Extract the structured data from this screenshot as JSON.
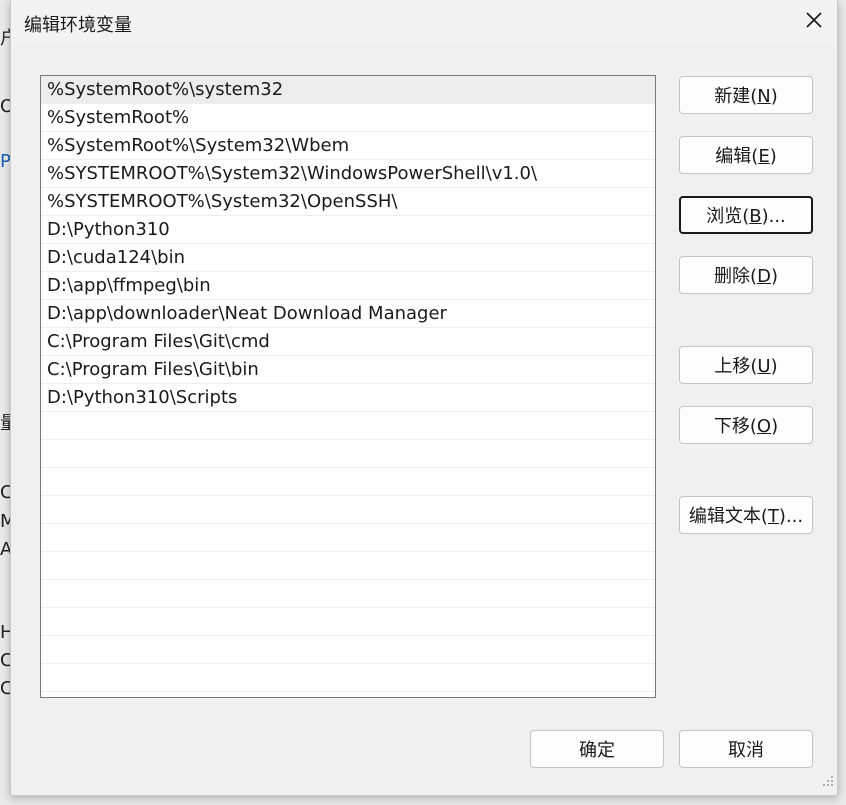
{
  "background": {
    "fragments": [
      "户",
      "O",
      "P",
      "量",
      "C",
      "ME",
      "AN",
      "HI",
      "C",
      "C"
    ]
  },
  "dialog": {
    "title": "编辑环境变量",
    "close_icon": "close-icon"
  },
  "list": {
    "items": [
      "%SystemRoot%\\system32",
      "%SystemRoot%",
      "%SystemRoot%\\System32\\Wbem",
      "%SYSTEMROOT%\\System32\\WindowsPowerShell\\v1.0\\",
      "%SYSTEMROOT%\\System32\\OpenSSH\\",
      "D:\\Python310",
      "D:\\cuda124\\bin",
      "D:\\app\\ffmpeg\\bin",
      "D:\\app\\downloader\\Neat Download Manager",
      "C:\\Program Files\\Git\\cmd",
      "C:\\Program Files\\Git\\bin",
      "D:\\Python310\\Scripts"
    ],
    "selected_index": 0
  },
  "buttons": {
    "new": {
      "prefix": "新建(",
      "key": "N",
      "suffix": ")"
    },
    "edit": {
      "prefix": "编辑(",
      "key": "E",
      "suffix": ")"
    },
    "browse": {
      "prefix": "浏览(",
      "key": "B",
      "suffix": ")..."
    },
    "delete": {
      "prefix": "删除(",
      "key": "D",
      "suffix": ")"
    },
    "move_up": {
      "prefix": "上移(",
      "key": "U",
      "suffix": ")"
    },
    "move_down": {
      "prefix": "下移(",
      "key": "O",
      "suffix": ")"
    },
    "edit_text": {
      "prefix": "编辑文本(",
      "key": "T",
      "suffix": ")..."
    }
  },
  "footer": {
    "ok": "确定",
    "cancel": "取消"
  }
}
